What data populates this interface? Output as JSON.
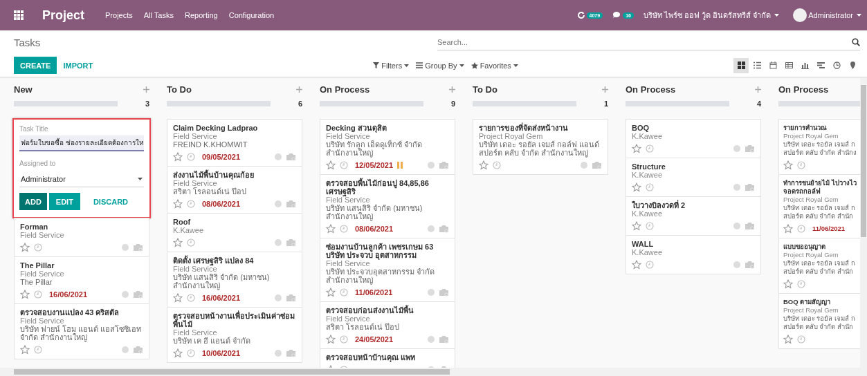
{
  "navbar": {
    "brand": "Project",
    "menu": [
      "Projects",
      "All Tasks",
      "Reporting",
      "Configuration"
    ],
    "activity_count": "4079",
    "message_count": "16",
    "company": "บริษัท ไพร์ซ ออฟ วู้ด อินดรัสทรีส์ จำกัด",
    "user": "Administrator"
  },
  "control_panel": {
    "breadcrumb": "Tasks",
    "search": {
      "placeholder": "Search..."
    },
    "buttons": [
      "CREATE",
      "IMPORT"
    ],
    "filters": [
      "Filters",
      "Group By",
      "Favorites"
    ],
    "views": [
      {
        "kind": "kanban",
        "selected": true
      },
      {
        "kind": "list",
        "selected": false
      },
      {
        "kind": "calendar",
        "selected": false
      },
      {
        "kind": "pivot",
        "selected": false
      },
      {
        "kind": "graph",
        "selected": false
      },
      {
        "kind": "gantt",
        "selected": false
      },
      {
        "kind": "activity",
        "selected": false
      },
      {
        "kind": "map",
        "selected": false
      }
    ]
  },
  "columns": [
    {
      "title": "New",
      "count": "3",
      "quick_create": {
        "title_label": "Task Title",
        "title_value": "ฟอร์มใบขอซื้อ ช่องรายละเอียดต้องการให",
        "assign_label": "Assigned to",
        "assign_value": "Administrator",
        "buttons": [
          "ADD",
          "EDIT",
          "DISCARD"
        ]
      },
      "cards": [
        {
          "title": "Forman",
          "project": "Field Service",
          "blocked": false
        },
        {
          "title": "The Pillar",
          "project": "Field Service",
          "partner": [
            "The Pillar"
          ],
          "deadline": "16/06/2021",
          "blocked": false
        },
        {
          "title": "ตรวจสอบงานแปลง 43 คริสตัล",
          "project": "Field Service",
          "partner": [
            "บริษัท ฟายน์ โฮม แอนด์ แอสโซซิเอท",
            "จำกัด สำนักงานใหญ่"
          ],
          "blocked": false
        }
      ]
    },
    {
      "title": "To Do",
      "count": "6",
      "cards": [
        {
          "title": "Claim Decking Ladprao",
          "project": "Field Service",
          "partner": [
            "FREIND K.KHOMWIT"
          ],
          "deadline": "09/05/2021",
          "blocked": false
        },
        {
          "title": "ส่งงานไม้พื้นบ้านคุณก้อย",
          "project": "Field Service",
          "partner": [
            "สริตา โรลอนด์เน่ ป๊อป"
          ],
          "deadline": "08/06/2021",
          "blocked": false
        },
        {
          "title": "Roof",
          "project": "K.Kawee",
          "blocked": false
        },
        {
          "title": "ติดตั้ง เศรษฐสิริ แปลง 84",
          "project": "Field Service",
          "partner": [
            "บริษัท แสนสิริ จำกัด (มหาชน)",
            "สำนักงานใหญ่"
          ],
          "deadline": "16/06/2021",
          "blocked": false
        },
        {
          "title": "ตรวจสอบหน้างานเพื่อประเมินค่าซ่อมพื้นไม้",
          "project": "Field Service",
          "partner": [
            "บริษัท เค อี แอนด์ จำกัด"
          ],
          "deadline": "10/06/2021",
          "blocked": false
        }
      ]
    },
    {
      "title": "On Process",
      "count": "9",
      "cards": [
        {
          "title": "Decking สวนดุสิต",
          "project": "Field Service",
          "partner": [
            "บริษัท รักลูก เอ็ดดูเท็กซ์ จำกัด",
            "สำนักงานใหญ่"
          ],
          "deadline": "12/05/2021",
          "blocked": true
        },
        {
          "title": "ตรวจสอบพื้นไม้ก่อนปู 84,85,86 เศรษฐสิริ",
          "project": "Field Service",
          "partner": [
            "บริษัท แสนสิริ จำกัด (มหาชน)",
            "สำนักงานใหญ่"
          ],
          "deadline": "08/06/2021",
          "blocked": false
        },
        {
          "title": "ซ่อมงานบ้านลูกค้า เพชรเกษม 63 บริษัท ประจวบ อุตสาหกรรม",
          "project": "Field Service",
          "partner": [
            "บริษัท ประจวบอุตสาหกรรม จำกัด",
            "สำนักงานใหญ่"
          ],
          "deadline": "11/06/2021",
          "blocked": false
        },
        {
          "title": "ตรวจสอบก่อนส่งงานไม้พื้น",
          "project": "Field Service",
          "partner": [
            "สริตา โรลอนด์เน่ ป๊อป"
          ],
          "deadline": "24/05/2021",
          "blocked": false
        },
        {
          "title": "ตรวจสอบหน้าบ้านคุณ แพท",
          "blocked": false
        }
      ]
    },
    {
      "title": "To Do",
      "count": "1",
      "cards": [
        {
          "title": "รายการของที่จัดส่งหน้างาน",
          "project": "Project Royal Gem",
          "partner": [
            "บริษัท เดอะ รอยัล เจมส์ กอล์ฟ แอนด์",
            "สปอร์ต คลับ จำกัด สำนักงานใหญ่"
          ],
          "blocked": false
        }
      ]
    },
    {
      "title": "On Process",
      "count": "4",
      "cards": [
        {
          "title": "BOQ",
          "project": "K.Kawee",
          "blocked": false
        },
        {
          "title": "Structure",
          "project": "K.Kawee",
          "blocked": false
        },
        {
          "title": "ใบวางบิลงวดที่ 2",
          "project": "K.Kawee",
          "blocked": false
        },
        {
          "title": "WALL",
          "project": "K.Kawee",
          "blocked": false
        }
      ]
    },
    {
      "title": "On Process",
      "cards": [
        {
          "title": "รายการคำนวณ",
          "project": "Project Royal Gem",
          "partner": [
            "บริษัท เดอะ รอยัล เจมส์ ก",
            "สปอร์ต คลับ จำกัด สำนักง"
          ],
          "blocked": false
        },
        {
          "title": "ทำการขนย้ายไม้ ไปวางไว\nจอดรถกอล์ฟ",
          "project": "Project Royal Gem",
          "partner": [
            "บริษัท เดอะ รอยัล เจมส์ ก",
            "สปอร์ต คลับ จำกัด สำนัก"
          ],
          "deadline": "11/06/2021",
          "blocked": false
        },
        {
          "title": "แบบขออนุญาต",
          "project": "Project Royal Gem",
          "partner": [
            "บริษัท เดอะ รอยัล เจมส์ ก",
            "สปอร์ต คลับ จำกัด สำนัก"
          ],
          "blocked": false
        },
        {
          "title": "BOQ ตามสัญญา",
          "project": "Project Royal Gem",
          "partner": [
            "บริษัท เดอะ รอยัล เจมส์ ก",
            "สปอร์ต คลับ จำกัด สำนัก"
          ],
          "blocked": false
        }
      ]
    }
  ]
}
